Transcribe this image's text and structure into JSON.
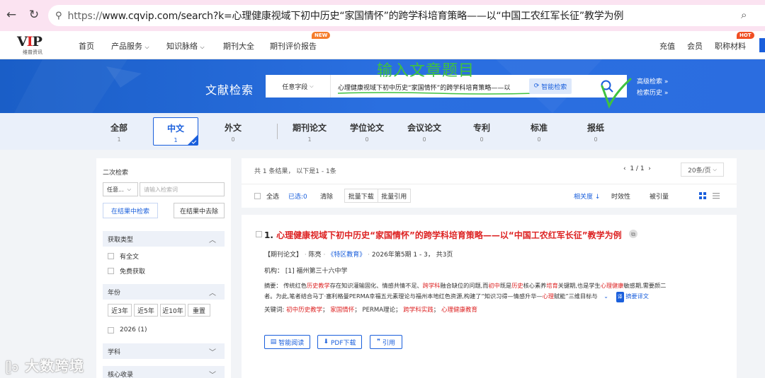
{
  "browser": {
    "url_proto": "https://",
    "url_rest": "www.cqvip.com/search?k=心理健康视域下初中历史“家国情怀”的跨学科培育策略——以“中国工农红军长征”教学为例",
    "back_icon": "back-arrow-icon",
    "reload_icon": "reload-icon"
  },
  "header": {
    "logo_text": "VIP",
    "logo_sub": "维普资讯",
    "nav": [
      "首页",
      "产品服务",
      "知识脉络",
      "期刊大全",
      "期刊评价报告"
    ],
    "new_badge": "NEW",
    "right": [
      "充值",
      "会员",
      "职称材料"
    ],
    "hot_badge": "HOT"
  },
  "search": {
    "title": "文献检索",
    "field": "任意字段",
    "query_pre": "心理健康视域下初中历史",
    "query_hl": "“家国情怀”",
    "query_post": "的跨学科培育策略——以",
    "smart_label": "智能检索",
    "advanced": "高级检索 »",
    "history": "检索历史 »",
    "annotation": "输入文章题目"
  },
  "tabs": [
    {
      "label": "全部",
      "count": "1"
    },
    {
      "label": "中文",
      "count": "1"
    },
    {
      "label": "外文",
      "count": "0"
    },
    {
      "label": "期刊论文",
      "count": "1"
    },
    {
      "label": "学位论文",
      "count": "0"
    },
    {
      "label": "会议论文",
      "count": "0"
    },
    {
      "label": "专利",
      "count": "0"
    },
    {
      "label": "标准",
      "count": "0"
    },
    {
      "label": "报纸",
      "count": "0"
    }
  ],
  "left": {
    "secondary_title": "二次检索",
    "field": "任意...",
    "placeholder": "请输入检索词",
    "search_in": "在结果中检索",
    "exclude": "在结果中去除",
    "access_title": "获取类型",
    "full_text": "有全文",
    "free": "免费获取",
    "year_title": "年份",
    "year_btns": [
      "近3年",
      "近5年",
      "近10年",
      "重置"
    ],
    "year_item": "2026 (1)",
    "subject_title": "学科",
    "core_title": "核心收录"
  },
  "results": {
    "summary": "共 1 条结果， 以下是1 - 1条",
    "page": "1 / 1",
    "per_page": "20条/页",
    "select_all": "全选",
    "selected": "已选:0",
    "clear": "清除",
    "batch_download": "批量下载",
    "batch_cite": "批量引用",
    "sort_relevance": "相关度 ↓",
    "sort_time": "时效性",
    "sort_cited": "被引量",
    "item": {
      "num": "1.",
      "title_pre": "心理健康视域下初中历史“家国情怀”的跨学科培育策略——以“中国工农红军长征”教学为例",
      "type": "【期刊论文】",
      "author": "陈亮",
      "journal": "《特区教育》",
      "issue": "2026年第5期 1 - 3，  共3页",
      "org_label": "机构：",
      "org": "[1] 福州第三十六中学",
      "abstract_label": "摘要：",
      "abstract_l1_a": "传统红色",
      "abstract_l1_b": "历史",
      "abstract_l1_c": "教学",
      "abstract_l1_d": "存在知识灌输固化、情感共情不足、",
      "abstract_l1_e": "跨学科",
      "abstract_l1_f": "融合缺位的问题,而",
      "abstract_l1_g": "初中",
      "abstract_l1_h": "既是",
      "abstract_l1_i": "历史",
      "abstract_l1_j": "核心素养",
      "abstract_l1_k": "培育",
      "abstract_l1_l": "关键期,也是学生",
      "abstract_l1_m": "心理健康",
      "abstract_l1_n": "敏感期,需要颜二",
      "abstract_l2_a": "者。为此,笔者结合马丁·塞利格曼PERMA幸福五元素理论与福州本地红色资源,构建了“知识习得—情感升华—",
      "abstract_l2_b": "心理",
      "abstract_l2_c": "赋能”三维目标与",
      "translate": "摘要译文",
      "kw_label": "关键词:",
      "keywords": [
        "初中历史教学",
        "家国情怀",
        "PERMA理论",
        "跨学科实践",
        "心理健康教育"
      ],
      "btn_read": "智能阅读",
      "btn_pdf": "PDF下载",
      "btn_cite": "引用"
    }
  },
  "watermark": "大数跨境"
}
